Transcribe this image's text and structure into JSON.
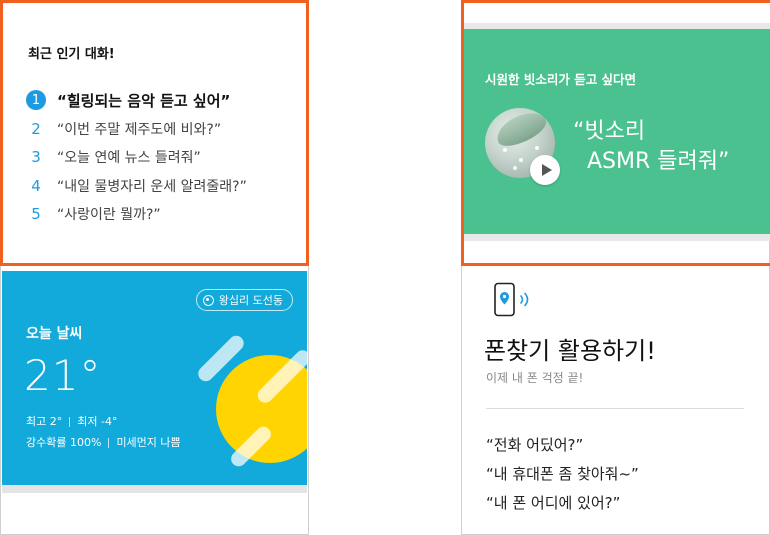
{
  "popular": {
    "title": "최근 인기 대화!",
    "items": [
      {
        "num": "1",
        "text": "“힐링되는 음악 듣고 싶어”"
      },
      {
        "num": "2",
        "text": "“이번 주말 제주도에 비와?”"
      },
      {
        "num": "3",
        "text": "“오늘 연예 뉴스 들려줘”"
      },
      {
        "num": "4",
        "text": "“내일 물병자리 운세 알려줄래?”"
      },
      {
        "num": "5",
        "text": "“사랑이란 뭘까?”"
      }
    ]
  },
  "weather": {
    "location": "왕십리 도선동",
    "title": "오늘 날씨",
    "temperature": "21°",
    "high": "최고 2°",
    "low": "최저 -4°",
    "rain_prob": "강수확률 100%",
    "dust": "미세먼지 나쁨",
    "colors": {
      "background": "#12aadb",
      "sun": "#ffd400"
    }
  },
  "rain_card": {
    "subtitle": "시원한 빗소리가 듣고 싶다면",
    "quote_line1": "“빗소리",
    "quote_line2": "ASMR 들려줘”",
    "colors": {
      "background": "#4bc18f"
    }
  },
  "phone_card": {
    "icon": "phone-location-icon",
    "title": "폰찾기 활용하기!",
    "subtitle": "이제 내 폰 걱정 끝!",
    "examples": [
      "“전화 어딨어?”",
      "“내 휴대폰 좀 찾아줘~”",
      "“내 폰 어디에 있어?”"
    ]
  },
  "colors": {
    "highlight_border": "#f0611f",
    "accent_blue": "#1e9be0"
  }
}
